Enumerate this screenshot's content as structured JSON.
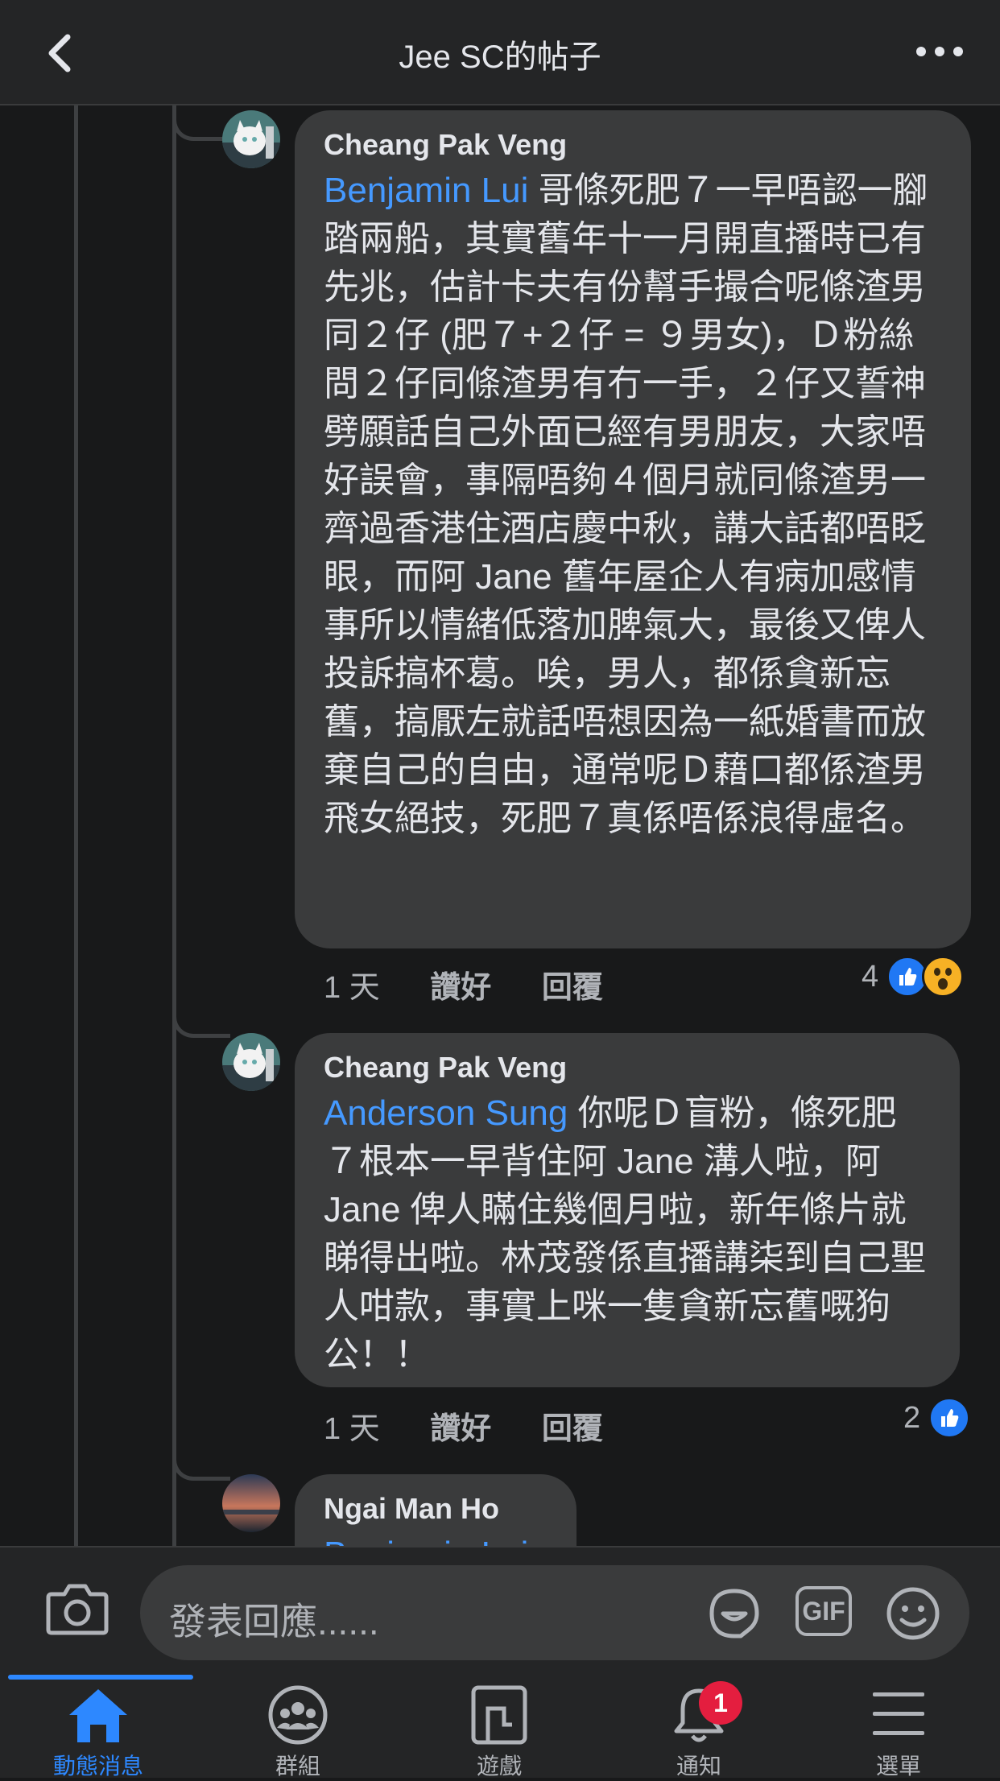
{
  "header": {
    "title": "Jee SC的帖子",
    "back_icon": "chevron-left-icon",
    "more_icon": "more-horizontal-icon"
  },
  "comments": [
    {
      "author": "Cheang Pak Veng",
      "mention": "Benjamin Lui",
      "text": " 哥條死肥７一早唔認一腳踏兩船，其實舊年十一月開直播時已有先兆，估計卡夫有份幫手撮合呢條渣男同２仔 (肥７+２仔 = ９男女)，Ｄ粉絲問２仔同條渣男有冇一手，２仔又誓神劈願話自己外面已經有男朋友，大家唔好誤會，事隔唔夠４個月就同條渣男一齊過香港住酒店慶中秋，講大話都唔眨眼，而阿 Jane 舊年屋企人有病加感情事所以情緒低落加脾氣大，最後又俾人投訴搞杯葛。唉，男人，都係貪新忘舊，搞厭左就話唔想因為一紙婚書而放棄自己的自由，通常呢Ｄ藉口都係渣男飛女絕技，死肥７真係唔係浪得虛名。",
      "time": "1 天",
      "like_label": "讚好",
      "reply_label": "回覆",
      "reaction_count": "4"
    },
    {
      "author": "Cheang Pak Veng",
      "mention": "Anderson Sung",
      "text": " 你呢Ｄ盲粉，條死肥７根本一早背住阿 Jane 溝人啦，阿 Jane 俾人瞞住幾個月啦，新年條片就睇得出啦。林茂發係直播講柒到自己聖人咁款，事實上咪一隻貪新忘舊嘅狗公！！",
      "time": "1 天",
      "like_label": "讚好",
      "reply_label": "回覆",
      "reaction_count": "2"
    },
    {
      "author": "Ngai Man Ho",
      "mention": "Benjamin Lui"
    }
  ],
  "composer": {
    "placeholder": "發表回應......",
    "gif_label": "GIF",
    "camera_icon": "camera-icon",
    "sticker_icon": "sticker-icon",
    "emoji_icon": "emoji-icon"
  },
  "tabs": [
    {
      "label": "動態消息",
      "icon": "home-icon",
      "active": true
    },
    {
      "label": "群組",
      "icon": "groups-icon"
    },
    {
      "label": "遊戲",
      "icon": "gaming-icon"
    },
    {
      "label": "通知",
      "icon": "bell-icon",
      "badge": "1"
    },
    {
      "label": "選單",
      "icon": "menu-icon"
    }
  ],
  "colors": {
    "background": "#18191a",
    "surface": "#242526",
    "bubble": "#3a3b3c",
    "mention": "#4599ff",
    "accent": "#2d88ff",
    "badge": "#e41e3f"
  }
}
